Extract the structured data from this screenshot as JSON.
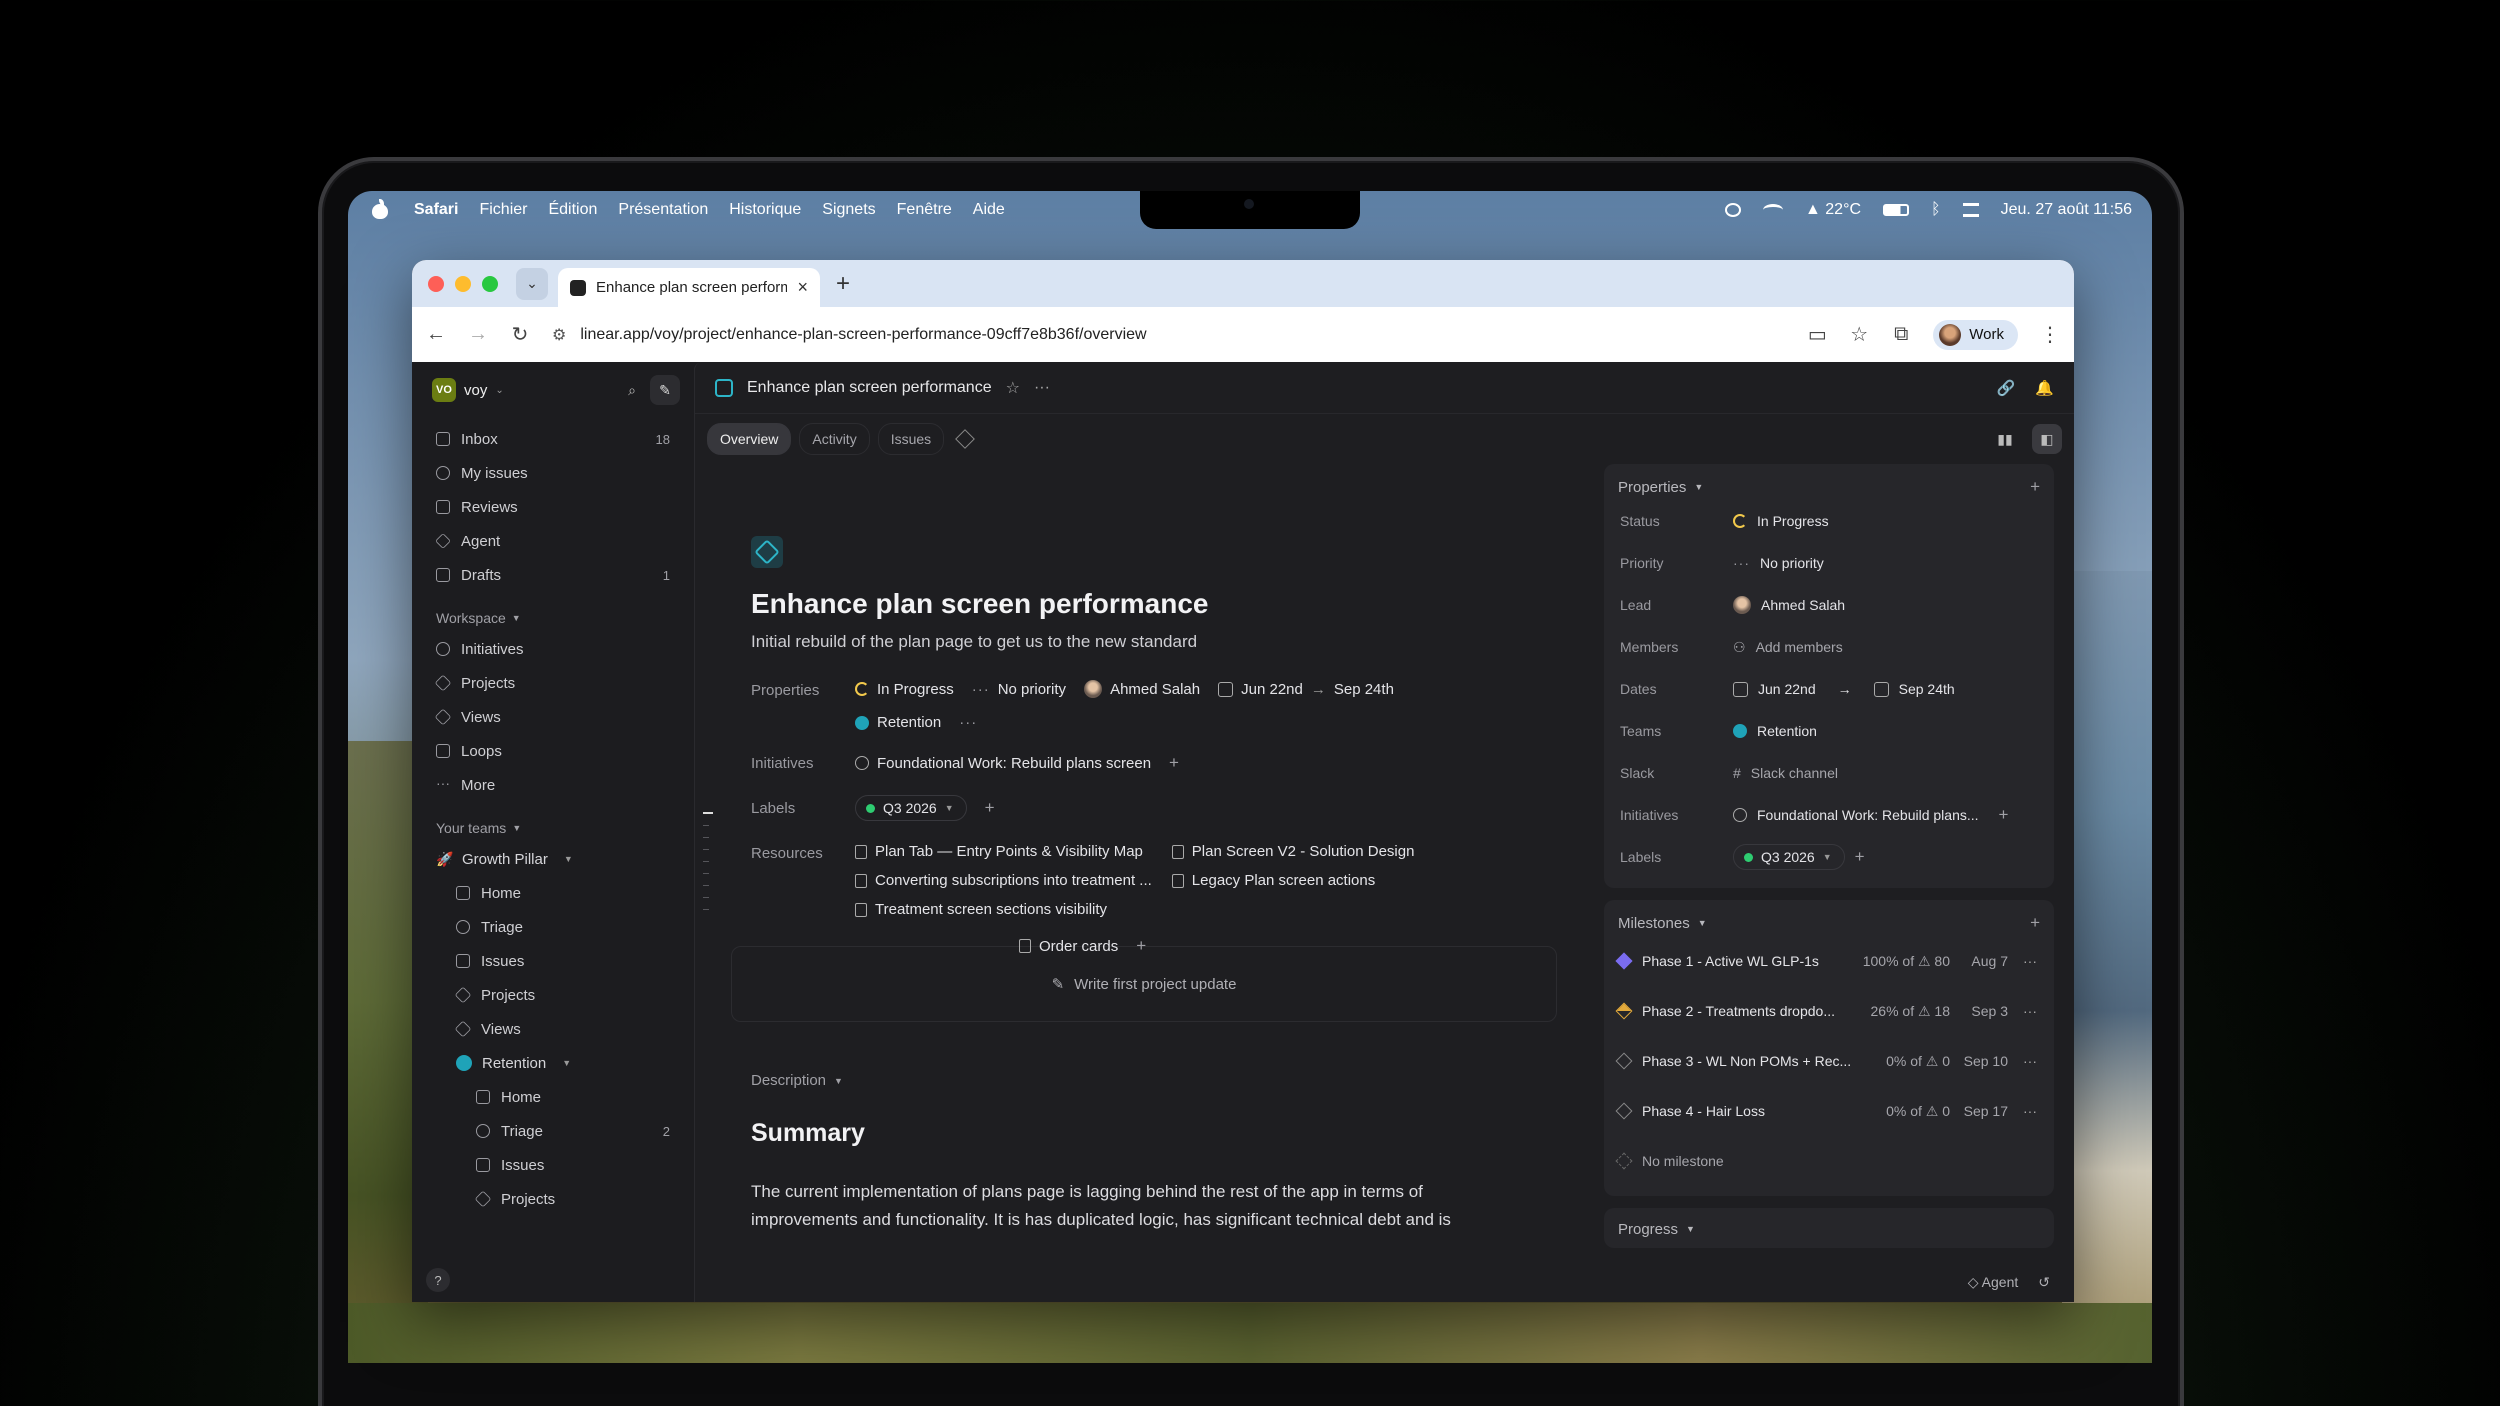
{
  "menubar": {
    "app": "Safari",
    "items": [
      "Fichier",
      "Édition",
      "Présentation",
      "Historique",
      "Signets",
      "Fenêtre",
      "Aide"
    ],
    "temperature": "22°C",
    "datetime": "Jeu. 27 août  11:56"
  },
  "browser": {
    "tab_title": "Enhance plan screen perform",
    "url": "linear.app/voy/project/enhance-plan-screen-performance-09cff7e8b36f/overview",
    "profile": "Work"
  },
  "workspace": {
    "logo": "VO",
    "name": "voy"
  },
  "nav": [
    {
      "label": "Inbox",
      "count": "18",
      "icon": "inbox-icon"
    },
    {
      "label": "My issues",
      "count": "",
      "icon": "my-issues-icon"
    },
    {
      "label": "Reviews",
      "count": "",
      "icon": "reviews-icon"
    },
    {
      "label": "Agent",
      "count": "",
      "icon": "agent-icon"
    },
    {
      "label": "Drafts",
      "count": "1",
      "icon": "drafts-icon"
    }
  ],
  "workspace_section": {
    "title": "Workspace",
    "items": [
      "Initiatives",
      "Projects",
      "Views",
      "Loops",
      "More"
    ]
  },
  "teams_section": {
    "title": "Your teams",
    "growth": {
      "name": "Growth Pillar",
      "items": [
        "Home",
        "Triage",
        "Issues",
        "Projects",
        "Views"
      ]
    },
    "retention": {
      "name": "Retention",
      "items": [
        {
          "label": "Home",
          "count": ""
        },
        {
          "label": "Triage",
          "count": "2"
        },
        {
          "label": "Issues",
          "count": ""
        },
        {
          "label": "Projects",
          "count": ""
        }
      ]
    }
  },
  "help": "?",
  "topbar": {
    "title": "Enhance plan screen performance"
  },
  "tabs": [
    "Overview",
    "Activity",
    "Issues"
  ],
  "project": {
    "title": "Enhance plan screen performance",
    "subtitle": "Initial rebuild of the plan page to get us to the new standard",
    "properties_label": "Properties",
    "status": "In Progress",
    "priority": "No priority",
    "lead": "Ahmed Salah",
    "start": "Jun 22nd",
    "end": "Sep 24th",
    "team": "Retention",
    "initiatives_label": "Initiatives",
    "initiative": "Foundational Work: Rebuild plans screen",
    "labels_label": "Labels",
    "label": "Q3 2026",
    "resources_label": "Resources",
    "resources": [
      "Plan Tab — Entry Points & Visibility Map",
      "Plan Screen V2 - Solution Design",
      "Converting subscriptions into treatment ...",
      "Legacy Plan screen actions",
      "Treatment screen sections visibility",
      "Order cards"
    ],
    "update_cta": "Write first project update",
    "description_label": "Description",
    "summary": "Summary",
    "body": "The current implementation of plans page is lagging behind the rest of the app in terms of improvements and functionality. It is has duplicated logic, has significant technical debt and is"
  },
  "panel": {
    "properties_title": "Properties",
    "rows": [
      {
        "key": "Status",
        "value": "In Progress"
      },
      {
        "key": "Priority",
        "value": "No priority"
      },
      {
        "key": "Lead",
        "value": "Ahmed Salah"
      },
      {
        "key": "Members",
        "value": "Add members"
      },
      {
        "key": "Dates",
        "value": "Jun 22nd",
        "value2": "Sep 24th"
      },
      {
        "key": "Teams",
        "value": "Retention"
      },
      {
        "key": "Slack",
        "value": "Slack channel"
      },
      {
        "key": "Initiatives",
        "value": "Foundational Work: Rebuild plans..."
      },
      {
        "key": "Labels",
        "value": "Q3 2026"
      }
    ],
    "milestones_title": "Milestones",
    "milestones": [
      {
        "name": "Phase 1 - Active WL GLP-1s",
        "stat": "100% of ⚠ 80",
        "date": "Aug 7"
      },
      {
        "name": "Phase 2 - Treatments dropdo...",
        "stat": "26% of ⚠ 18",
        "date": "Sep 3"
      },
      {
        "name": "Phase 3 - WL Non POMs + Rec...",
        "stat": "0% of ⚠ 0",
        "date": "Sep 10"
      },
      {
        "name": "Phase 4 - Hair Loss",
        "stat": "0% of ⚠ 0",
        "date": "Sep 17"
      }
    ],
    "no_milestone": "No milestone",
    "progress_title": "Progress"
  },
  "bottom": {
    "agent": "Agent"
  }
}
